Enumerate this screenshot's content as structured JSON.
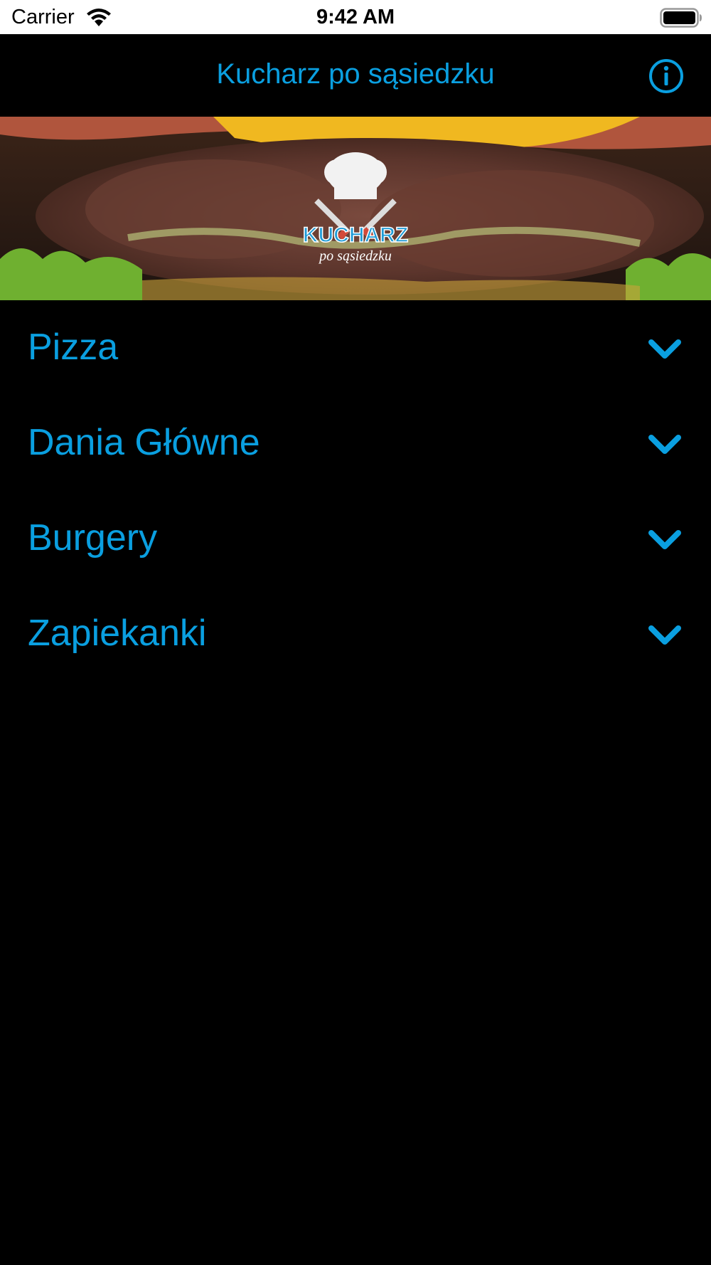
{
  "colors": {
    "accent": "#0a9fe0",
    "background": "#000000",
    "status_bar": "#ffffff"
  },
  "status_bar": {
    "carrier": "Carrier",
    "time": "9:42 AM"
  },
  "nav": {
    "title": "Kucharz po sąsiedzku",
    "info_icon": "info-circle-icon"
  },
  "hero": {
    "logo_text": "KUCHARZ",
    "logo_subtext": "po sąsiedzku"
  },
  "menu": {
    "items": [
      {
        "label": "Pizza",
        "icon": "chevron-down-icon"
      },
      {
        "label": "Dania Główne",
        "icon": "chevron-down-icon"
      },
      {
        "label": "Burgery",
        "icon": "chevron-down-icon"
      },
      {
        "label": "Zapiekanki",
        "icon": "chevron-down-icon"
      }
    ]
  }
}
